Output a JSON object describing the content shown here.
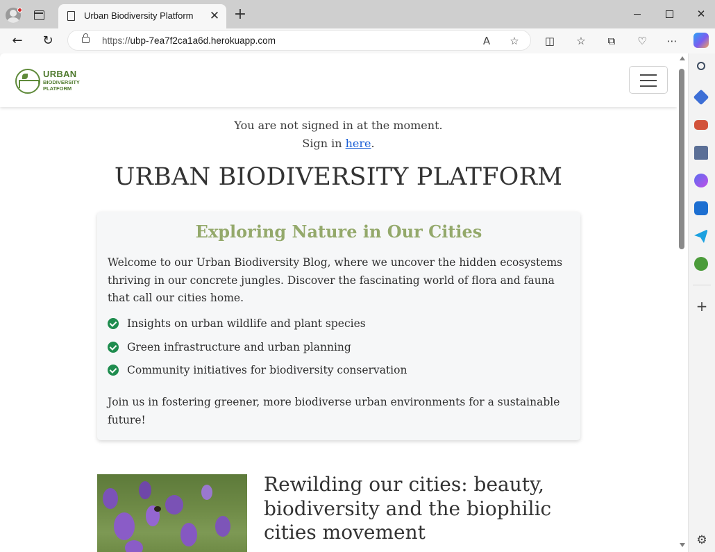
{
  "browser": {
    "tab_title": "Urban Biodiversity Platform",
    "url_protocol": "https://",
    "url_host": "ubp-7ea7f2ca1a6d.herokuapp.com"
  },
  "site": {
    "logo_lines": [
      "URBAN",
      "BIODIVERSITY",
      "PLATFORM"
    ],
    "signin": {
      "message": "You are not signed in at the moment.",
      "prefix": "Sign in",
      "link": "here",
      "suffix": "."
    },
    "title": "URBAN BIODIVERSITY PLATFORM",
    "intro_card": {
      "heading": "Exploring Nature in Our Cities",
      "intro": "Welcome to our Urban Biodiversity Blog, where we uncover the hidden ecosystems thriving in our concrete jungles. Discover the fascinating world of flora and fauna that call our cities home.",
      "features": [
        "Insights on urban wildlife and plant species",
        "Green infrastructure and urban planning",
        "Community initiatives for biodiversity conservation"
      ],
      "outro": "Join us in fostering greener, more biodiverse urban environments for a sustainable future!"
    },
    "post": {
      "title": "Rewilding our cities: beauty, biodiversity and the biophilic cities movement"
    }
  },
  "colors": {
    "card_heading": "#94a96b",
    "check": "#1e8c4e",
    "link": "#1a5fd6",
    "logo": "#4f7a2e"
  }
}
